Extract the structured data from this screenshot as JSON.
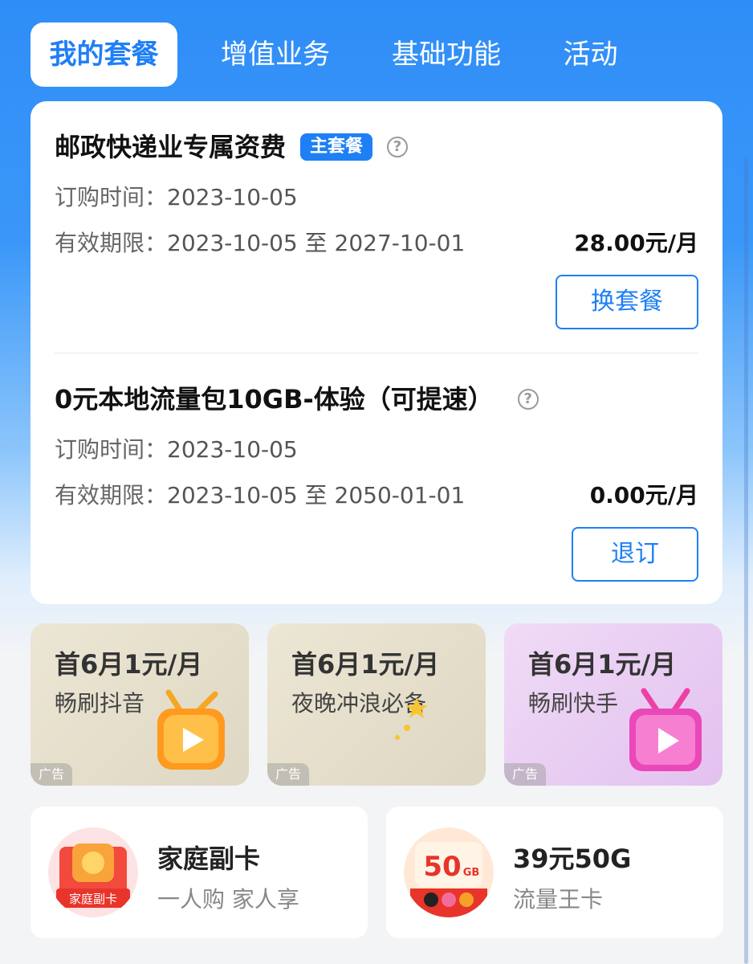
{
  "tabs": {
    "items": [
      {
        "label": "我的套餐"
      },
      {
        "label": "增值业务"
      },
      {
        "label": "基础功能"
      },
      {
        "label": "活动"
      }
    ]
  },
  "packages": [
    {
      "name": "邮政快递业专属资费",
      "badge": "主套餐",
      "order_label": "订购时间：",
      "order_date": "2023-10-05",
      "valid_label": "有效期限：",
      "valid_range": "2023-10-05 至 2027-10-01",
      "price": "28.00元/月",
      "action": "换套餐"
    },
    {
      "name": "0元本地流量包10GB-体验（可提速）",
      "order_label": "订购时间：",
      "order_date": "2023-10-05",
      "valid_label": "有效期限：",
      "valid_range": "2023-10-05 至 2050-01-01",
      "price": "0.00元/月",
      "action": "退订"
    }
  ],
  "help_glyph": "?",
  "promos": [
    {
      "title": "首6月1元/月",
      "subtitle": "畅刷抖音",
      "tag": "广告",
      "icon": "tv-icon"
    },
    {
      "title": "首6月1元/月",
      "subtitle": "夜晚冲浪必备",
      "tag": "广告",
      "icon": "moon-icon"
    },
    {
      "title": "首6月1元/月",
      "subtitle": "畅刷快手",
      "tag": "广告",
      "icon": "tv-icon"
    }
  ],
  "bottom_cards": [
    {
      "title": "家庭副卡",
      "subtitle": "一人购 家人享",
      "image_text": "家庭副卡"
    },
    {
      "title": "39元50G",
      "subtitle": "流量王卡",
      "image_text": "50",
      "image_unit": "GB"
    }
  ],
  "colors": {
    "accent": "#1f7ff5",
    "top_bg": "#2f8df7"
  }
}
